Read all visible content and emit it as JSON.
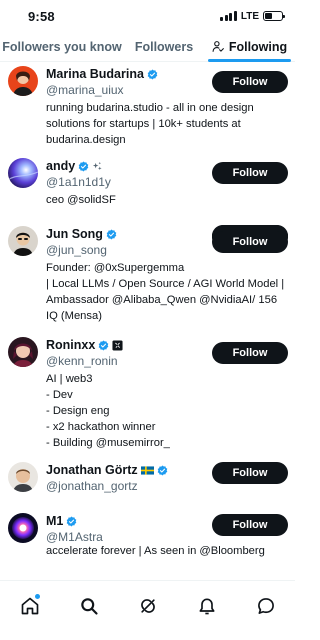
{
  "status_bar": {
    "time": "9:58",
    "network": "LTE",
    "battery_level": 0.45
  },
  "tabs": [
    {
      "label": "Followers you know",
      "active": false
    },
    {
      "label": "Followers",
      "active": false
    },
    {
      "label": "Following",
      "active": true
    }
  ],
  "users": [
    {
      "name": "Marina Budarina",
      "handle": "@marina_uiux",
      "bio": "running budarina.studio - all in one design solutions for startups | 10k+ students at budarina.design",
      "follow_label": "Follow",
      "verified": true,
      "badge": ""
    },
    {
      "name": "andy",
      "handle": "@1a1n1d1y",
      "bio": "ceo @solidSF",
      "follow_label": "Follow",
      "verified": true,
      "badge": "affiliate-sparkle-badge"
    },
    {
      "name": "Jun Song",
      "handle": "@jun_song",
      "bio": "Founder: @0xSupergemma\n| Local LLMs / Open Source / AGI World Model | Ambassador @Alibaba_Qwen @NvidiaAI/ 156 IQ (Mensa)",
      "follow_label": "Follow",
      "verified": true,
      "badge": ""
    },
    {
      "name": "Roninxx",
      "handle": "@kenn_ronin",
      "bio": "AI | web3\n- Dev\n- Design eng\n- x2 hackathon winner\n- Building @musemirror_",
      "follow_label": "Follow",
      "verified": true,
      "badge": "affiliate-square-badge"
    },
    {
      "name": "Jonathan Görtz",
      "handle": "@jonathan_gortz",
      "bio": "",
      "follow_label": "Follow",
      "verified": true,
      "badge": "sweden-flag"
    },
    {
      "name": "M1",
      "handle": "@M1Astra",
      "bio": "accelerate forever | As seen in @Bloomberg",
      "follow_label": "Follow",
      "verified": true,
      "badge": ""
    }
  ],
  "bottom_nav": [
    {
      "icon": "home-icon",
      "has_notification_dot": true
    },
    {
      "icon": "search-icon"
    },
    {
      "icon": "grok-icon"
    },
    {
      "icon": "bell-icon"
    },
    {
      "icon": "messages-icon"
    }
  ],
  "colors": {
    "accent": "#1d9bf0",
    "text": "#0f1419",
    "muted": "#536471",
    "button": "#0f1419"
  }
}
